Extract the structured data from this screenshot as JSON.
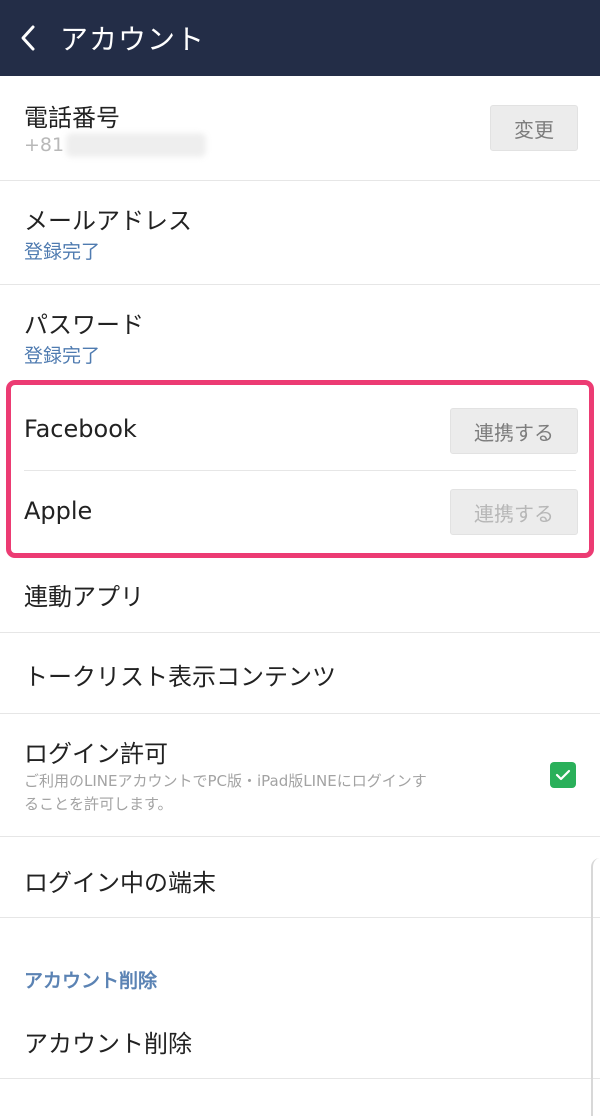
{
  "header": {
    "title": "アカウント",
    "back_icon": "chevron-left-icon"
  },
  "phone": {
    "label": "電話番号",
    "value": "+81",
    "button": "変更"
  },
  "email": {
    "label": "メールアドレス",
    "status": "登録完了"
  },
  "password": {
    "label": "パスワード",
    "status": "登録完了"
  },
  "facebook": {
    "label": "Facebook",
    "button": "連携する"
  },
  "apple": {
    "label": "Apple",
    "button": "連携する"
  },
  "linked_apps": {
    "label": "連動アプリ"
  },
  "talk_list": {
    "label": "トークリスト表示コンテンツ"
  },
  "login_permission": {
    "label": "ログイン許可",
    "description_line1": "ご利用のLINEアカウントでPC版・iPad版LINEにログインす",
    "description_line2": "ることを許可します。",
    "checked": true
  },
  "logged_in_devices": {
    "label": "ログイン中の端末"
  },
  "delete_section": {
    "header": "アカウント削除",
    "item": "アカウント削除"
  },
  "colors": {
    "header_bg": "#232d47",
    "highlight": "#ec3b73",
    "status_blue": "#4f7bb0",
    "checkbox_green": "#2ab05a"
  }
}
